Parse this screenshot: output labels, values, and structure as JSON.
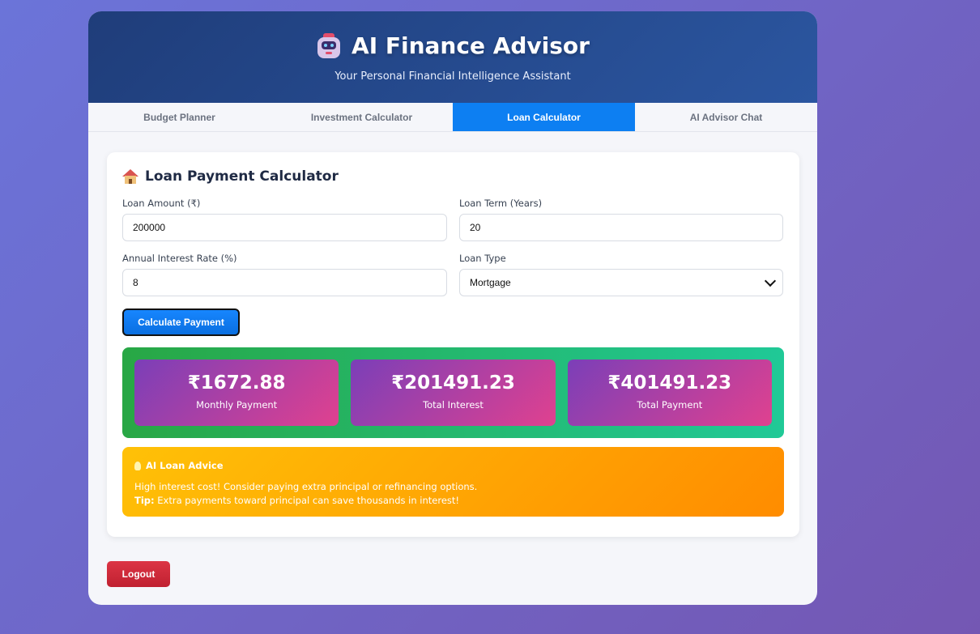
{
  "header": {
    "title": "AI Finance Advisor",
    "subtitle": "Your Personal Financial Intelligence Assistant",
    "logo_icon": "robot-icon"
  },
  "tabs": [
    {
      "label": "Budget Planner",
      "active": false
    },
    {
      "label": "Investment Calculator",
      "active": false
    },
    {
      "label": "Loan Calculator",
      "active": true
    },
    {
      "label": "AI Advisor Chat",
      "active": false
    }
  ],
  "calculator": {
    "title": "Loan Payment Calculator",
    "title_icon": "house-icon",
    "loan_amount": {
      "label": "Loan Amount (₹)",
      "value": "200000"
    },
    "loan_term": {
      "label": "Loan Term (Years)",
      "value": "20"
    },
    "interest_rate": {
      "label": "Annual Interest Rate (%)",
      "value": "8"
    },
    "loan_type": {
      "label": "Loan Type",
      "value": "Mortgage"
    },
    "calculate_label": "Calculate Payment"
  },
  "results": [
    {
      "value": "₹1672.88",
      "label": "Monthly Payment"
    },
    {
      "value": "₹201491.23",
      "label": "Total Interest"
    },
    {
      "value": "₹401491.23",
      "label": "Total Payment"
    }
  ],
  "advice": {
    "title": "AI Loan Advice",
    "icon": "lightbulb-icon",
    "line1": "High interest cost! Consider paying extra principal or refinancing options.",
    "tip_label": "Tip:",
    "tip_text": " Extra payments toward principal can save thousands in interest!"
  },
  "logout_label": "Logout",
  "colors": {
    "active_tab": "#0d7ff2",
    "header_start": "#1f3d7a",
    "header_end": "#2b56a0",
    "results_bg": "#28a745",
    "stat_start": "#7b3fb8",
    "stat_end": "#e0418f",
    "advice_start": "#ffc107",
    "advice_end": "#ff8c00",
    "logout": "#dc3545"
  }
}
